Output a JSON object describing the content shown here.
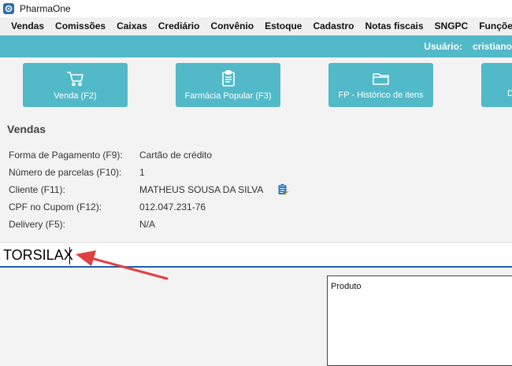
{
  "window": {
    "title": "PharmaOne"
  },
  "menu": [
    "Vendas",
    "Comissões",
    "Caixas",
    "Crediário",
    "Convênio",
    "Estoque",
    "Cadastro",
    "Notas fiscais",
    "SNGPC",
    "Funções a"
  ],
  "userbar": {
    "label": "Usuário:",
    "value": "cristiano"
  },
  "actions": [
    {
      "label": "Venda (F2)",
      "icon": "cart-icon"
    },
    {
      "label": "Farmácia Popular (F3)",
      "icon": "clipboard-icon"
    },
    {
      "label": "FP - Histórico de itens",
      "icon": "folder-icon"
    },
    {
      "label": "D",
      "icon": "partial-icon"
    }
  ],
  "section": {
    "title": "Vendas"
  },
  "info": [
    {
      "label": "Forma de Pagamento (F9):",
      "value": "Cartão de crédito"
    },
    {
      "label": "Número de parcelas (F10):",
      "value": "1"
    },
    {
      "label": "Cliente (F11):",
      "value": "MATHEUS SOUSA DA SILVA"
    },
    {
      "label": "CPF no Cupom (F12):",
      "value": "012.047.231-76"
    },
    {
      "label": "Delivery (F5):",
      "value": "N/A"
    }
  ],
  "search": {
    "value": "TORSILAX"
  },
  "product_table": {
    "header": "Produto"
  },
  "colors": {
    "accent": "#52b9c8",
    "focus_border": "#1f5fa8",
    "annotation_arrow": "#e04040"
  }
}
